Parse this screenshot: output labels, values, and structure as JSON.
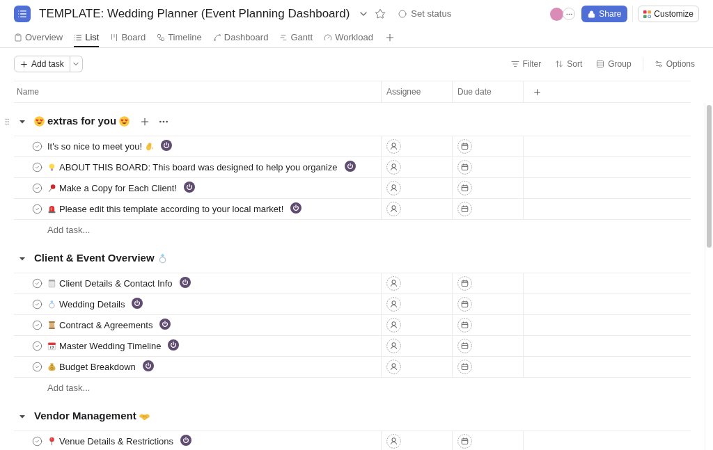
{
  "project": {
    "title": "TEMPLATE: Wedding Planner (Event Planning Dashboard)",
    "starred": false,
    "status_label": "Set status"
  },
  "header_buttons": {
    "share": "Share",
    "customize": "Customize"
  },
  "tabs": [
    {
      "label": "Overview",
      "kind": "overview",
      "selected": false
    },
    {
      "label": "List",
      "kind": "list",
      "selected": true
    },
    {
      "label": "Board",
      "kind": "board",
      "selected": false
    },
    {
      "label": "Timeline",
      "kind": "timeline",
      "selected": false
    },
    {
      "label": "Dashboard",
      "kind": "dashboard",
      "selected": false
    },
    {
      "label": "Gantt",
      "kind": "gantt",
      "selected": false
    },
    {
      "label": "Workload",
      "kind": "workload",
      "selected": false
    }
  ],
  "toolbar": {
    "add_task": "Add task",
    "actions": [
      {
        "label": "Filter",
        "kind": "filter"
      },
      {
        "label": "Sort",
        "kind": "sort"
      },
      {
        "label": "Group",
        "kind": "group"
      },
      {
        "label": "Options",
        "kind": "options"
      }
    ]
  },
  "table": {
    "columns": [
      "Name",
      "Assignee",
      "Due date"
    ],
    "sections": [
      {
        "title": "extras for you",
        "kind": "hearteyes",
        "expanded": true,
        "hovered": true,
        "tasks": [
          {
            "name": "It's so nice to meet you!",
            "kind": "wave",
            "completed": false
          },
          {
            "name": "ABOUT THIS BOARD: This board was designed to help you organize",
            "kind": "bulb",
            "completed": false
          },
          {
            "name": "Make a Copy for Each Client!",
            "kind": "pushpin",
            "completed": false
          },
          {
            "name": "Please edit this template according to your local market!",
            "kind": "siren",
            "completed": false
          }
        ],
        "add_task": "Add task..."
      },
      {
        "title": "Client & Event Overview",
        "kind": "ring",
        "expanded": true,
        "hovered": false,
        "tasks": [
          {
            "name": "Client Details & Contact Info",
            "kind": "notepad",
            "completed": false
          },
          {
            "name": "Wedding Details",
            "kind": "ring",
            "completed": false
          },
          {
            "name": "Contract & Agreements",
            "kind": "scroll",
            "completed": false
          },
          {
            "name": "Master Wedding Timeline",
            "kind": "calendar",
            "completed": false
          },
          {
            "name": "Budget Breakdown",
            "kind": "moneybag",
            "completed": false
          }
        ],
        "add_task": "Add task..."
      },
      {
        "title": "Vendor Management",
        "kind": "handshake",
        "expanded": true,
        "hovered": false,
        "tasks": [
          {
            "name": "Venue Details & Restrictions",
            "kind": "location",
            "completed": false
          }
        ]
      }
    ]
  }
}
